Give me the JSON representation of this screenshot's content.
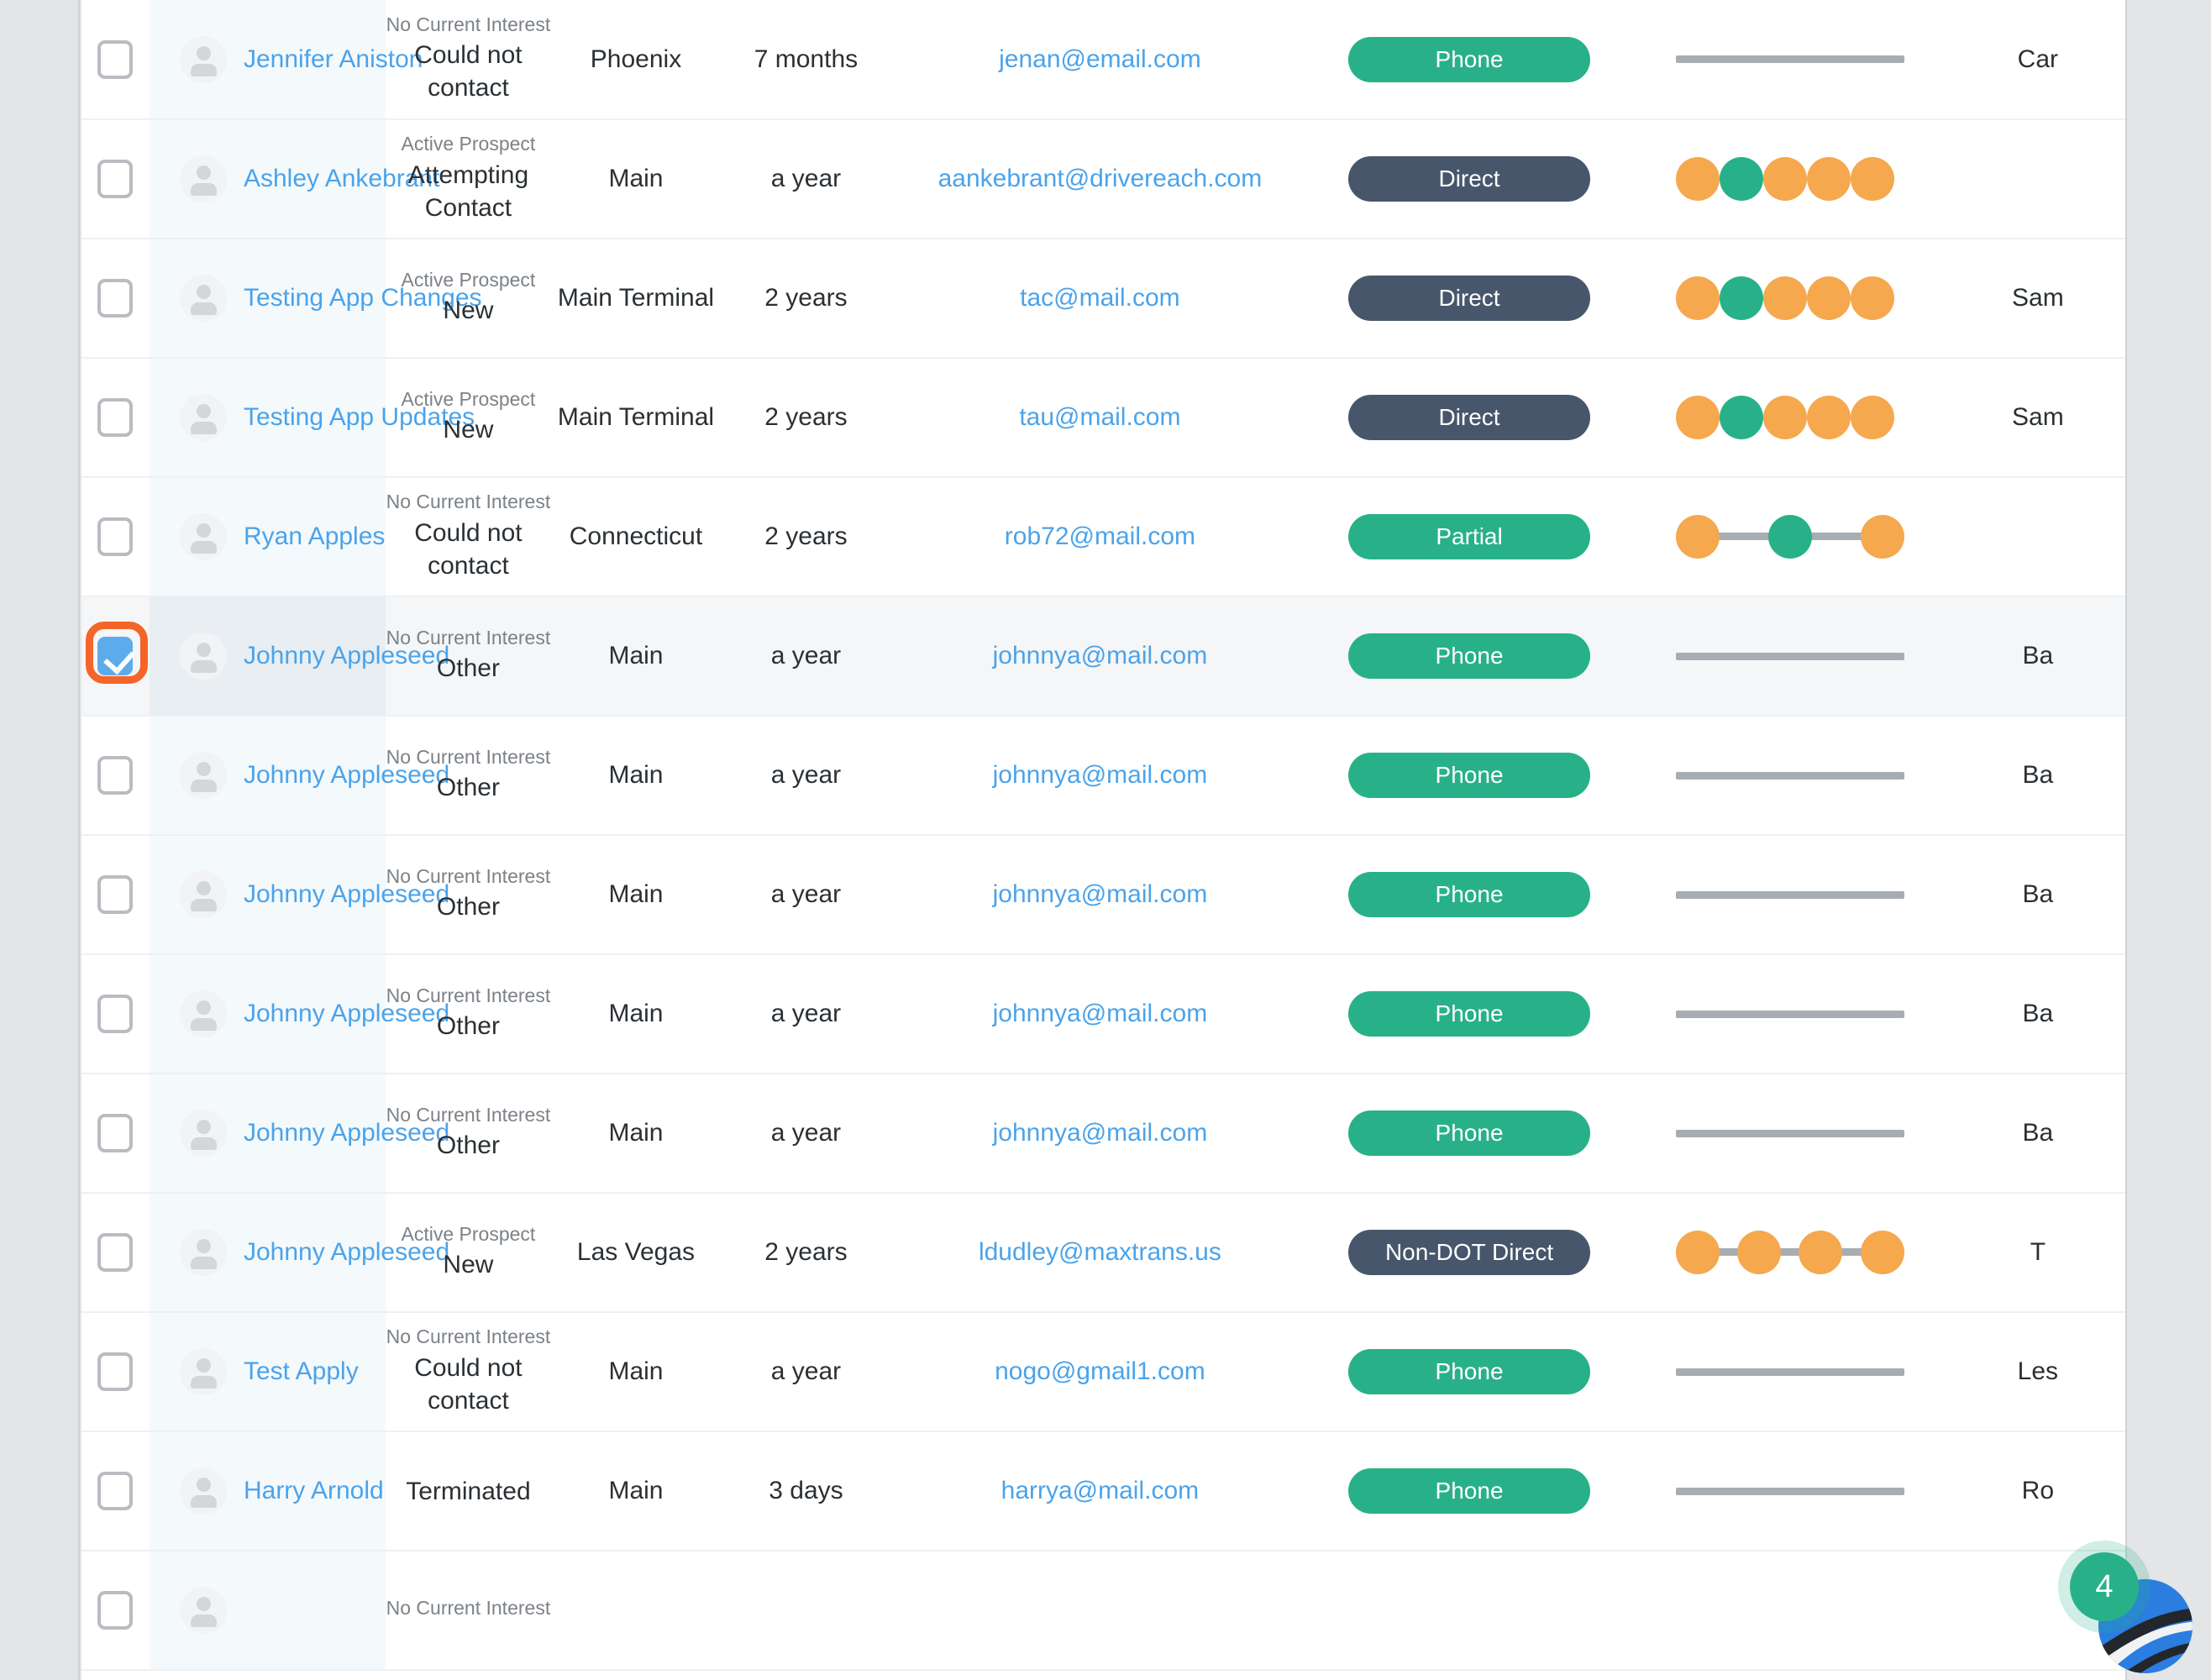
{
  "colors": {
    "link": "#4ba3ea",
    "green": "#28b188",
    "slate": "#47566b",
    "orange": "#f5a84e",
    "track": "#a7adb3",
    "row_tint": "#f4f9fc",
    "selected_tint": "#e8eef2",
    "gutter": "#e3e5e7",
    "highlight_ring": "#f4652a"
  },
  "chat_widget": {
    "unread_count": "4",
    "logo_icon": "road-swoosh-logo-icon"
  },
  "table": {
    "rows": [
      {
        "checked": false,
        "highlighted": false,
        "selected": false,
        "avatar_icon": "person-avatar-icon",
        "name": "Jennifer Aniston",
        "status_sub": "No Current Interest",
        "status_main": "Could not contact",
        "city": "Phoenix",
        "duration": "7 months",
        "email": "jenan@email.com",
        "badge": {
          "label": "Phone",
          "style": "green"
        },
        "steps": {
          "type": "bar",
          "dots": []
        },
        "last": "Car"
      },
      {
        "checked": false,
        "highlighted": false,
        "selected": false,
        "avatar_icon": "person-avatar-icon",
        "name": "Ashley Ankebrant",
        "status_sub": "Active Prospect",
        "status_main": "Attempting Contact",
        "city": "Main",
        "duration": "a year",
        "email": "aankebrant@drivereach.com",
        "badge": {
          "label": "Direct",
          "style": "slate"
        },
        "steps": {
          "type": "packed",
          "dots": [
            "orange",
            "green",
            "orange",
            "orange",
            "orange"
          ]
        },
        "last": ""
      },
      {
        "checked": false,
        "highlighted": false,
        "selected": false,
        "avatar_icon": "person-avatar-icon",
        "name": "Testing App Changes",
        "status_sub": "Active Prospect",
        "status_main": "New",
        "city": "Main Terminal",
        "duration": "2 years",
        "email": "tac@mail.com",
        "badge": {
          "label": "Direct",
          "style": "slate"
        },
        "steps": {
          "type": "packed",
          "dots": [
            "orange",
            "green",
            "orange",
            "orange",
            "orange"
          ]
        },
        "last": "Sam"
      },
      {
        "checked": false,
        "highlighted": false,
        "selected": false,
        "avatar_icon": "person-avatar-icon",
        "name": "Testing App Updates",
        "status_sub": "Active Prospect",
        "status_main": "New",
        "city": "Main Terminal",
        "duration": "2 years",
        "email": "tau@mail.com",
        "badge": {
          "label": "Direct",
          "style": "slate"
        },
        "steps": {
          "type": "packed",
          "dots": [
            "orange",
            "green",
            "orange",
            "orange",
            "orange"
          ]
        },
        "last": "Sam"
      },
      {
        "checked": false,
        "highlighted": false,
        "selected": false,
        "avatar_icon": "person-avatar-icon",
        "name": "Ryan Apples",
        "status_sub": "No Current Interest",
        "status_main": "Could not contact",
        "city": "Connecticut",
        "duration": "2 years",
        "email": "rob72@mail.com",
        "badge": {
          "label": "Partial",
          "style": "green"
        },
        "steps": {
          "type": "spread",
          "dots": [
            "orange",
            "green",
            "orange"
          ]
        },
        "last": ""
      },
      {
        "checked": true,
        "highlighted": true,
        "selected": true,
        "avatar_icon": "person-avatar-icon",
        "name": "Johnny Appleseed",
        "status_sub": "No Current Interest",
        "status_main": "Other",
        "city": "Main",
        "duration": "a year",
        "email": "johnnya@mail.com",
        "badge": {
          "label": "Phone",
          "style": "green"
        },
        "steps": {
          "type": "bar",
          "dots": []
        },
        "last": "Ba"
      },
      {
        "checked": false,
        "highlighted": false,
        "selected": false,
        "avatar_icon": "person-avatar-icon",
        "name": "Johnny Appleseed",
        "status_sub": "No Current Interest",
        "status_main": "Other",
        "city": "Main",
        "duration": "a year",
        "email": "johnnya@mail.com",
        "badge": {
          "label": "Phone",
          "style": "green"
        },
        "steps": {
          "type": "bar",
          "dots": []
        },
        "last": "Ba"
      },
      {
        "checked": false,
        "highlighted": false,
        "selected": false,
        "avatar_icon": "person-avatar-icon",
        "name": "Johnny Appleseed",
        "status_sub": "No Current Interest",
        "status_main": "Other",
        "city": "Main",
        "duration": "a year",
        "email": "johnnya@mail.com",
        "badge": {
          "label": "Phone",
          "style": "green"
        },
        "steps": {
          "type": "bar",
          "dots": []
        },
        "last": "Ba"
      },
      {
        "checked": false,
        "highlighted": false,
        "selected": false,
        "avatar_icon": "person-avatar-icon",
        "name": "Johnny Appleseed",
        "status_sub": "No Current Interest",
        "status_main": "Other",
        "city": "Main",
        "duration": "a year",
        "email": "johnnya@mail.com",
        "badge": {
          "label": "Phone",
          "style": "green"
        },
        "steps": {
          "type": "bar",
          "dots": []
        },
        "last": "Ba"
      },
      {
        "checked": false,
        "highlighted": false,
        "selected": false,
        "avatar_icon": "person-avatar-icon",
        "name": "Johnny Appleseed",
        "status_sub": "No Current Interest",
        "status_main": "Other",
        "city": "Main",
        "duration": "a year",
        "email": "johnnya@mail.com",
        "badge": {
          "label": "Phone",
          "style": "green"
        },
        "steps": {
          "type": "bar",
          "dots": []
        },
        "last": "Ba"
      },
      {
        "checked": false,
        "highlighted": false,
        "selected": false,
        "avatar_icon": "person-avatar-icon",
        "name": "Johnny Appleseed",
        "status_sub": "Active Prospect",
        "status_main": "New",
        "city": "Las Vegas",
        "duration": "2 years",
        "email": "ldudley@maxtrans.us",
        "badge": {
          "label": "Non-DOT Direct",
          "style": "slate"
        },
        "steps": {
          "type": "packed4",
          "dots": [
            "orange",
            "orange",
            "orange",
            "orange"
          ]
        },
        "last": "T"
      },
      {
        "checked": false,
        "highlighted": false,
        "selected": false,
        "avatar_icon": "person-avatar-icon",
        "name": "Test Apply",
        "status_sub": "No Current Interest",
        "status_main": "Could not contact",
        "city": "Main",
        "duration": "a year",
        "email": "nogo@gmail1.com",
        "badge": {
          "label": "Phone",
          "style": "green"
        },
        "steps": {
          "type": "bar",
          "dots": []
        },
        "last": "Les"
      },
      {
        "checked": false,
        "highlighted": false,
        "selected": false,
        "avatar_icon": "person-avatar-icon",
        "name": "Harry Arnold",
        "status_sub": "",
        "status_main": "Terminated",
        "city": "Main",
        "duration": "3 days",
        "email": "harrya@mail.com",
        "badge": {
          "label": "Phone",
          "style": "green"
        },
        "steps": {
          "type": "bar",
          "dots": []
        },
        "last": "Ro"
      },
      {
        "checked": false,
        "highlighted": false,
        "selected": false,
        "avatar_icon": "person-avatar-icon",
        "name": "",
        "status_sub": "No Current Interest",
        "status_main": "",
        "city": "",
        "duration": "",
        "email": "",
        "badge": null,
        "steps": {
          "type": "none",
          "dots": []
        },
        "last": ""
      }
    ]
  }
}
